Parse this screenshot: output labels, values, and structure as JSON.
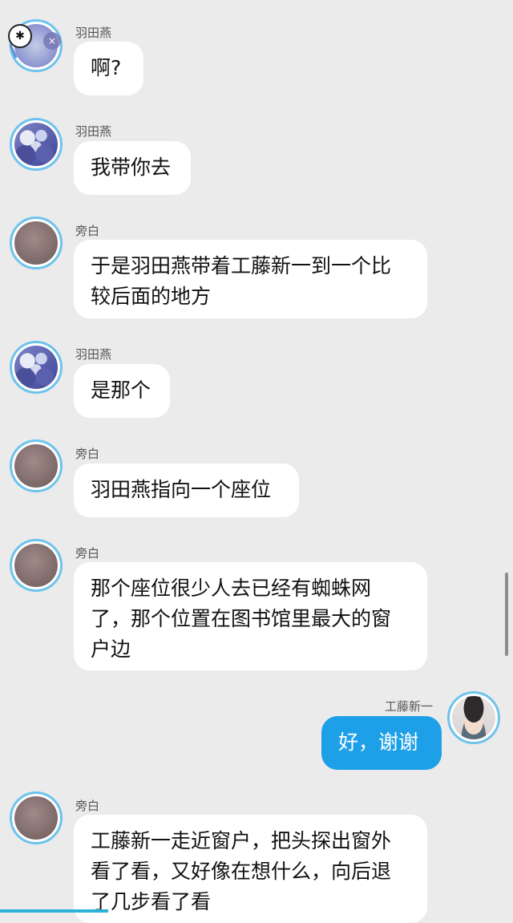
{
  "messages": [
    {
      "speaker": "羽田燕",
      "text": "啊?",
      "side": "left",
      "avatar": "yutian-avatar"
    },
    {
      "speaker": "羽田燕",
      "text": "我带你去",
      "side": "left",
      "avatar": "yutian-avatar"
    },
    {
      "speaker": "旁白",
      "text": "于是羽田燕带着工藤新一到一个比较后面的地方",
      "side": "left",
      "avatar": "narrator-avatar"
    },
    {
      "speaker": "羽田燕",
      "text": "是那个",
      "side": "left",
      "avatar": "yutian-avatar"
    },
    {
      "speaker": "旁白",
      "text": "羽田燕指向一个座位",
      "side": "left",
      "avatar": "narrator-avatar"
    },
    {
      "speaker": "旁白",
      "text": "那个座位很少人去已经有蜘蛛网了，那个位置在图书馆里最大的窗户边",
      "side": "left",
      "avatar": "narrator-avatar"
    },
    {
      "speaker": "工藤新一",
      "text": "好，谢谢",
      "side": "right",
      "avatar": "kudo-avatar"
    },
    {
      "speaker": "旁白",
      "text": "工藤新一走近窗户，把头探出窗外看了看，又好像在想什么，向后退了几步看了看",
      "side": "left",
      "avatar": "narrator-avatar"
    }
  ],
  "overlay": {
    "icon": "paw-icon",
    "close": "×"
  },
  "colors": {
    "accent": "#1ea0e8",
    "avatar_ring": "#6ec3ec",
    "background": "#ebebeb"
  }
}
